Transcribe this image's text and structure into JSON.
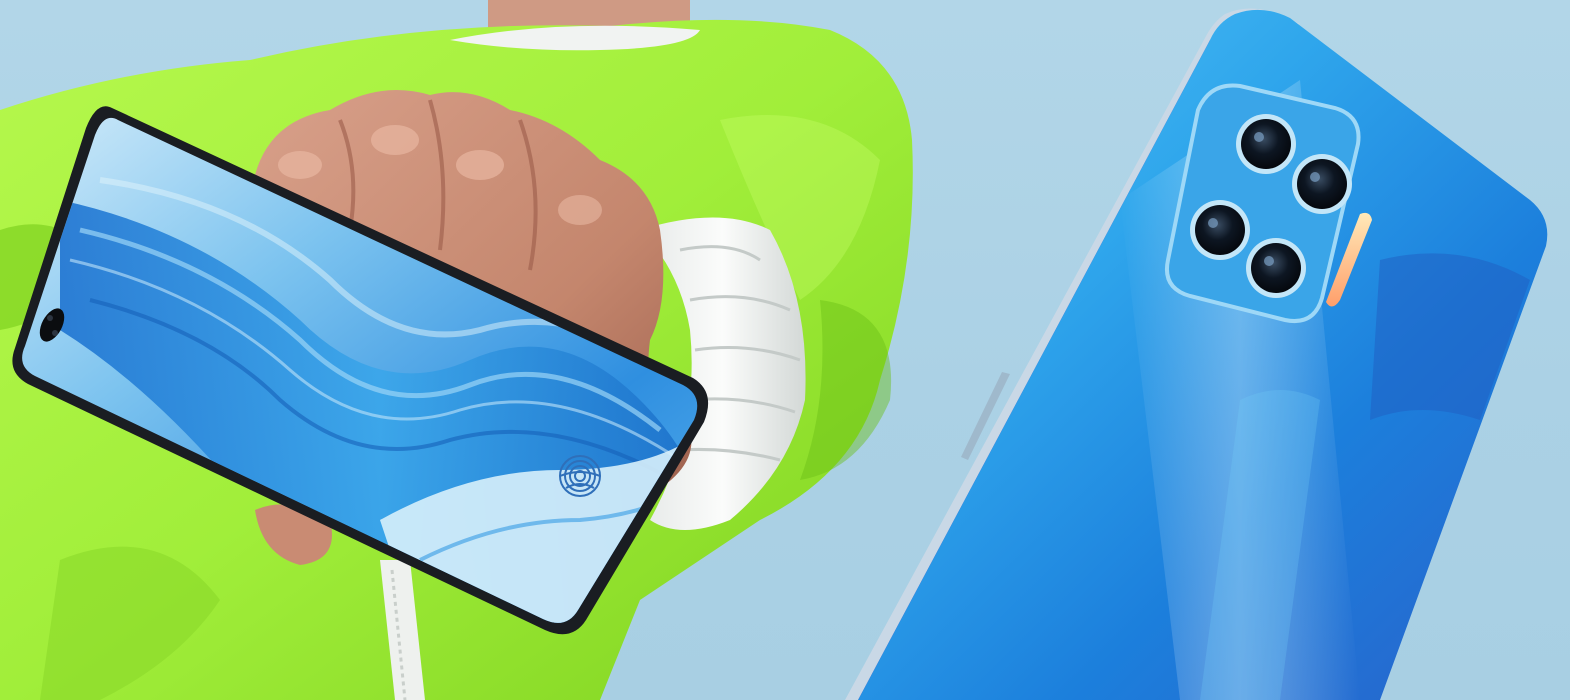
{
  "scene": {
    "background_color": "#aed3e6",
    "hoodie_color": "#a4f03c",
    "sleeve_color": "#f2f4f3",
    "skin_color": "#c98f78",
    "phone_back_color": "#2a9be6",
    "phone_back_accent": "#c83aa0",
    "screen_wave_color": "#2f95df"
  },
  "icons": {
    "fingerprint": "fingerprint-icon",
    "punch_hole": "punch-hole-camera-icon",
    "camera_module": "quad-camera-icon",
    "flash": "flash-icon"
  }
}
